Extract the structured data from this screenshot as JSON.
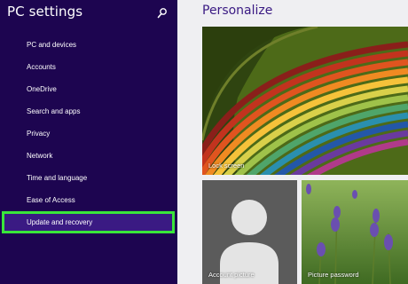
{
  "sidebar": {
    "title": "PC settings",
    "items": [
      {
        "label": "PC and devices"
      },
      {
        "label": "Accounts"
      },
      {
        "label": "OneDrive"
      },
      {
        "label": "Search and apps"
      },
      {
        "label": "Privacy"
      },
      {
        "label": "Network"
      },
      {
        "label": "Time and language"
      },
      {
        "label": "Ease of Access"
      },
      {
        "label": "Update and recovery",
        "selected": true
      }
    ]
  },
  "main": {
    "title": "Personalize",
    "tiles": {
      "lock_screen": "Lock screen",
      "account_picture": "Account picture",
      "picture_password": "Picture password"
    }
  },
  "icons": {
    "search": "search-icon"
  },
  "colors": {
    "sidebar_bg": "#1d0550",
    "accent": "#3a1a83",
    "highlight_outline": "#39e63a",
    "main_bg": "#efeff2"
  }
}
